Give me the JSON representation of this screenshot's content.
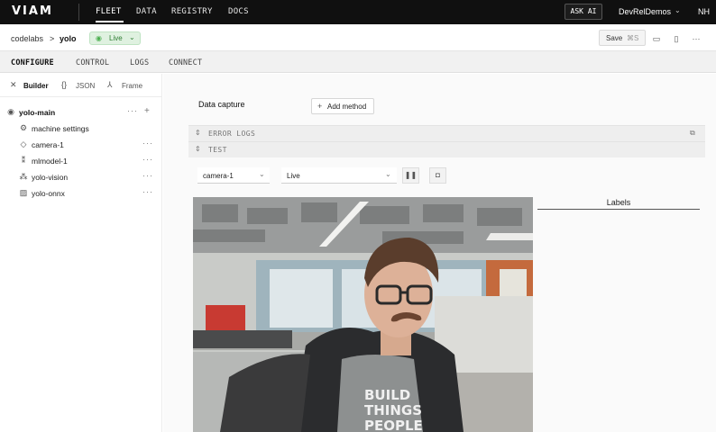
{
  "topnav": {
    "logo": "VIAM",
    "links": [
      {
        "label": "FLEET"
      },
      {
        "label": "DATA"
      },
      {
        "label": "REGISTRY"
      },
      {
        "label": "DOCS"
      }
    ],
    "ask_ai": "ASK AI",
    "org": "DevRelDemos",
    "initials": "NH"
  },
  "breadcrumb": {
    "location": "codelabs",
    "separator": ">",
    "machine": "yolo",
    "status": "Live",
    "status_color": "#2e7d32"
  },
  "toolbar": {
    "save_label": "Save",
    "save_shortcut": "⌘S"
  },
  "tabs": [
    {
      "label": "CONFIGURE"
    },
    {
      "label": "CONTROL"
    },
    {
      "label": "LOGS"
    },
    {
      "label": "CONNECT"
    }
  ],
  "sidebar": {
    "modes": [
      {
        "label": "Builder"
      },
      {
        "label": "JSON"
      },
      {
        "label": "Frame"
      }
    ],
    "root": "yolo-main",
    "items": [
      {
        "label": "machine settings",
        "icon": "gear-icon"
      },
      {
        "label": "camera-1",
        "icon": "diamond-icon"
      },
      {
        "label": "mlmodel-1",
        "icon": "model-icon"
      },
      {
        "label": "yolo-vision",
        "icon": "vision-icon"
      },
      {
        "label": "yolo-onnx",
        "icon": "image-icon"
      }
    ]
  },
  "main": {
    "section_title": "Data capture",
    "add_method": "Add method",
    "collapsed_sections": [
      {
        "label": "ERROR LOGS"
      },
      {
        "label": "TEST"
      }
    ],
    "camera_select": "camera-1",
    "mode_select": "Live",
    "labels_title": "Labels"
  },
  "colors": {
    "nav_bg": "#101010",
    "live_bg": "#dff1e0"
  }
}
